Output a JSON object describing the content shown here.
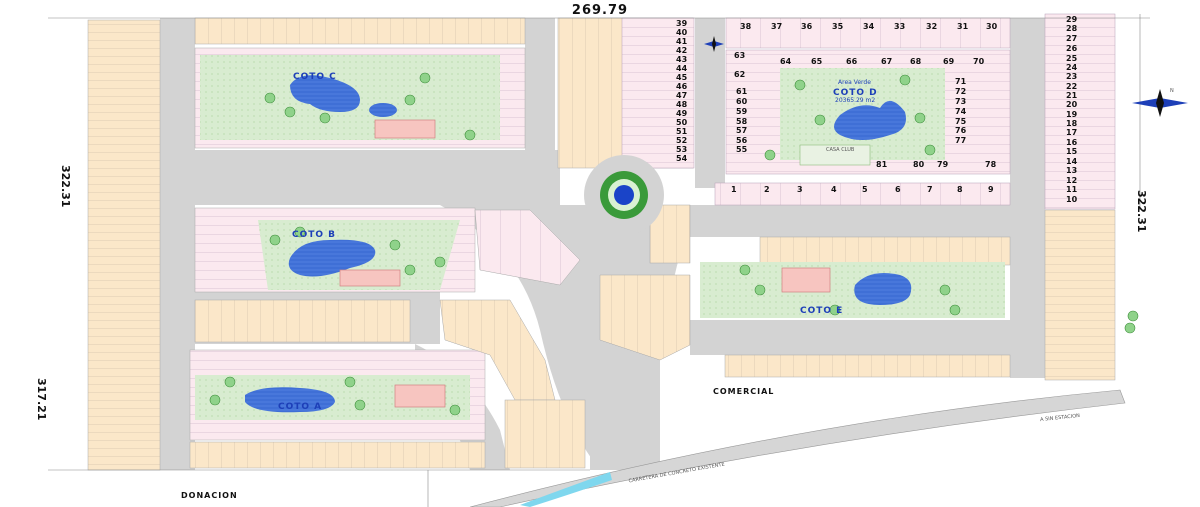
{
  "dimensions": {
    "top": "269.79",
    "left_upper": "322.31",
    "left_lower": "317.21",
    "right": "322.31"
  },
  "areas": {
    "coto_a": "COTO A",
    "coto_b": "COTO B",
    "coto_c": "COTO C",
    "coto_d": "COTO D",
    "coto_e": "COTO E",
    "area_verde": "Area Verde",
    "area_verde_sub": "20365.29 m2",
    "casa_club": "CASA CLUB",
    "comercial": "COMERCIAL",
    "donacion": "DONACION",
    "carretera": "CARRETERA DE CONCRETO EXISTENTE",
    "a_estacion": "A SIN ESTACION"
  },
  "lots": {
    "top_row": [
      "38",
      "37",
      "36",
      "35",
      "34",
      "33",
      "32",
      "31",
      "30"
    ],
    "left_column": [
      "39",
      "40",
      "41",
      "42",
      "43",
      "44",
      "45",
      "46",
      "47",
      "48",
      "49",
      "50",
      "51",
      "52",
      "53",
      "54"
    ],
    "right_column": [
      "29",
      "28",
      "27",
      "26",
      "25",
      "24",
      "23",
      "22",
      "21",
      "20",
      "19",
      "18",
      "17",
      "16",
      "15",
      "14",
      "13",
      "12",
      "11",
      "10"
    ],
    "bottom_row": [
      "1",
      "2",
      "3",
      "4",
      "5",
      "6",
      "7",
      "8",
      "9"
    ],
    "coto_d_left": [
      "63",
      "62",
      "61",
      "60",
      "59",
      "58",
      "57",
      "56",
      "55"
    ],
    "coto_d_top": [
      "64",
      "65",
      "66",
      "67",
      "68",
      "69",
      "70"
    ],
    "coto_d_right": [
      "71",
      "72",
      "73",
      "74",
      "75",
      "76",
      "77"
    ],
    "coto_d_bottom": [
      "81",
      "80",
      "79",
      "78"
    ]
  },
  "compass": {
    "label": "N"
  }
}
